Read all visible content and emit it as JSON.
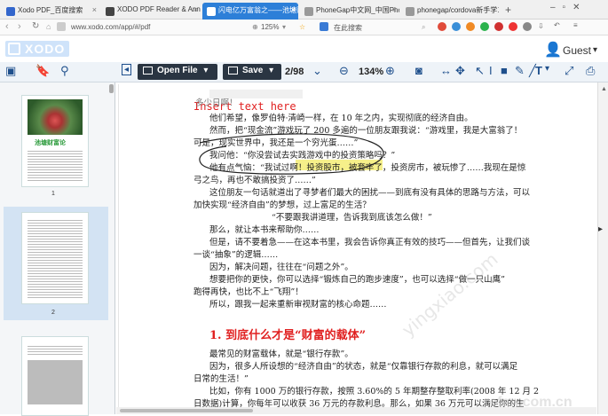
{
  "tabs": [
    {
      "label": "Xodo PDF_百度搜索",
      "color": "#3366cc"
    },
    {
      "label": "XODO PDF Reader & Annot",
      "color": "#444444"
    },
    {
      "label": "闪电亿万富翁之——池塘财富",
      "color": "#ffffff",
      "active": true
    },
    {
      "label": "PhoneGap中文网_中国Phone",
      "color": "#777777"
    },
    {
      "label": "phonegap/cordova新手学习",
      "color": "#777777"
    }
  ],
  "new_tab": "+",
  "address": {
    "url": "www.xodo.com/app/#/pdf",
    "zoom": "125%",
    "search_placeholder": "在此搜索"
  },
  "app": {
    "logo_text": "XODO",
    "user": "Guest",
    "user_caret": "▾"
  },
  "toolbar": {
    "open_file": "Open File",
    "save": "Save",
    "page": "2/98",
    "zoom": "134%"
  },
  "sidebar": {
    "pages": [
      "1",
      "2"
    ],
    "thumb1_title": "池塘财富论"
  },
  "annotation": {
    "insert_text": "Insert text here"
  },
  "doc": {
    "lines": [
      "多少日啊！",
      "他们希望，像罗伯特·清崎一样，在 10 年之内，实现彻底的经济自由。",
      "然而，把“现金流”游戏玩了 200 多遍的一位朋友跟我说：“游戏里，我是大富翁了！",
      "可是，现实世界中，我还是一个穷光蛋……”",
      "我问他：“你没尝试去实践游戏中的投资策略吗？”",
      "他有点气恼：“我试过啊！投资股市，被套牢了，投资房市，被玩惨了……我现在是惊",
      "弓之鸟，再也不敢搞投资了……”",
      "这位朋友一句话就道出了寻梦者们最大的困扰——到底有没有具体的思路与方法，可以",
      "加快实现“经济自由”的梦想，过上富足的生活？",
      "“不要跟我讲道理，告诉我到底该怎么做！”",
      "那么，就让本书来帮助你……",
      "但是，请不要着急——在这本书里，我会告诉你真正有效的技巧——但首先，让我们谈",
      "一谈“抽象”的逻辑……",
      "因为，解决问题，往往在“问题之外”。",
      "想要把你的更快，你可以选择“锻炼自己的跑步速度”，也可以选择“做一只山鹰”",
      "跑得再快，也比不上“飞翔”！",
      "所以，跟我一起来重新审视财富的核心命题……"
    ],
    "heading": "1. 到底什么才是“财富的载体”",
    "lines2": [
      "最常见的财富载体，就是“银行存款”。",
      "因为，很多人所设想的“经济自由”的状态，就是“仅靠银行存款的利息，就可以满足",
      "日常的生活！”",
      "比如，你有 1000 万的银行存款，按照 3.60%的 5 年期整存整取利率(2008 年 12 月 2",
      "日数据)计算，你每年可以收获 36 万元的存款利息。那么，如果 36 万元可以满足你的生"
    ],
    "highlight": "投资股市，被套牢了",
    "watermark": "yingxiao.com"
  },
  "colors": {
    "accent": "#2d7fd8",
    "toolbar_dark": "#2a3542",
    "heading_red": "#e02020",
    "highlight": "#f6f08a"
  }
}
